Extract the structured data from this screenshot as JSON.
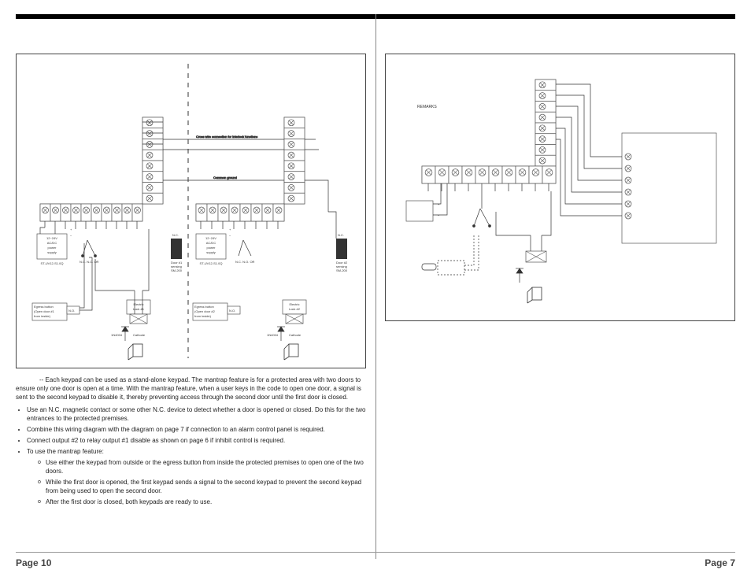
{
  "leftPageNum": "Page 10",
  "rightPageNum": "Page 7",
  "leftDiagram": {
    "crossWireLabel": "Cross wire connection for interlock functions",
    "commonGroundLabel": "Common ground",
    "unit1": {
      "psu": {
        "l1": "12~24V",
        "l2": "AC/DC",
        "l3": "power",
        "l4": "supply"
      },
      "psuModel": "ST-UV12-S1.0Q",
      "ncno": "N.C.  N.O.\nOR",
      "egress": {
        "l1": "Egress button",
        "l2": "(Open door #1",
        "l3": "from inside)",
        "no": "N.O."
      },
      "doorSense": {
        "l1": "Door #1",
        "l2": "sensing",
        "l3": "SM-200"
      },
      "nc": "N.C.",
      "lock": {
        "l1": "Electric",
        "l2": "Lock #1"
      },
      "diode": "1N4004",
      "cathode": "Cathode"
    },
    "unit2": {
      "psu": {
        "l1": "12~24V",
        "l2": "AC/DC",
        "l3": "power",
        "l4": "supply"
      },
      "psuModel": "ST-UV12-S1.0Q",
      "ncno": "N.C.  N.O.\nOR",
      "egress": {
        "l1": "Egress button",
        "l2": "(Open door #2",
        "l3": "from inside)",
        "no": "N.O."
      },
      "doorSense": {
        "l1": "Door #2",
        "l2": "sensing",
        "l3": "SM-200"
      },
      "nc": "N.C.",
      "lock": {
        "l1": "Electric",
        "l2": "Lock #2"
      },
      "diode": "1N4004",
      "cathode": "Cathode"
    }
  },
  "rightDiagram": {
    "remarks": "REMARKS"
  },
  "leftBody": {
    "intro": "-- Each keypad can be used as a stand-alone keypad. The mantrap feature is for a protected area with two doors to ensure only one door is open at a time. With the mantrap feature, when a user keys in the code to open one door, a signal is sent to the second keypad to disable it, thereby preventing access through the second door until the first door is closed.",
    "b1": "Use an N.C. magnetic contact or some other N.C. device to detect whether a door is opened or closed. Do this for the two entrances to the protected premises.",
    "b2": "Combine this wiring diagram with the diagram on page 7 if connection to an alarm control panel is required.",
    "b3": "Connect output #2 to relay output #1 disable as shown on page 6 if inhibit control is required.",
    "b4": "To use the mantrap feature:",
    "s1": "Use either the keypad from outside or the egress button from inside the protected premises to open one of the two doors.",
    "s2": "While the first door is opened, the first keypad sends a signal to the second keypad to prevent the second keypad from being used to open the second door.",
    "s3": "After the first door is closed, both keypads are ready to use."
  }
}
